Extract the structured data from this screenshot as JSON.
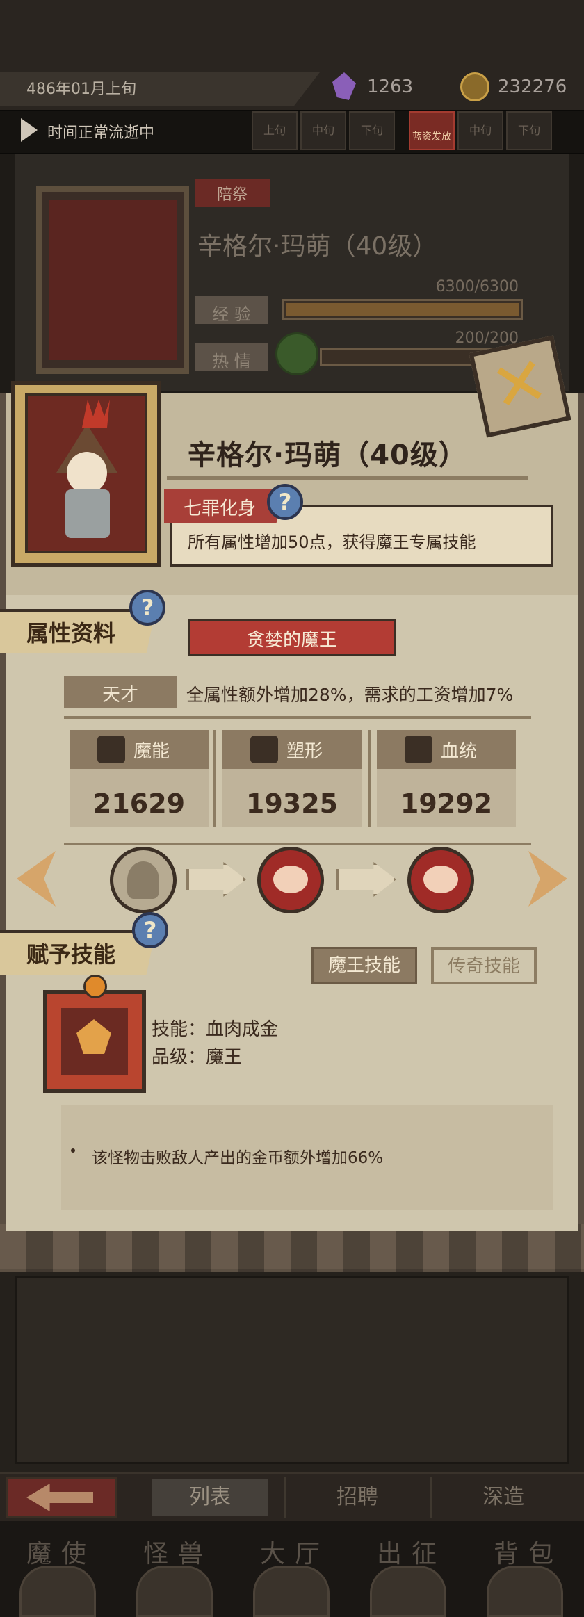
{
  "status": {
    "date": "486年01月上旬",
    "gems": "1263",
    "gold": "232276",
    "time_flow": "时间正常流逝中",
    "time_slots": [
      "上旬",
      "中旬",
      "下旬"
    ],
    "event_label": "蓝资发放",
    "time_slots_right": [
      "中旬",
      "下旬"
    ]
  },
  "background_card": {
    "tag": "陪祭",
    "name": "辛格尔·玛萌（40级）",
    "exp_label": "经 验",
    "exp_value": "6300/6300",
    "passion_label": "热 情",
    "passion_value": "200/200"
  },
  "character": {
    "name": "辛格尔·玛萌（40级）",
    "trait_tag": "七罪化身",
    "trait_desc": "所有属性增加50点，获得魔王专属技能",
    "close_icon": "close-icon"
  },
  "attributes": {
    "section_title": "属性资料",
    "title": "贪婪的魔王",
    "talent_label": "天才",
    "talent_desc": "全属性额外增加28%，需求的工资增加7%",
    "stats": [
      {
        "label": "魔能",
        "value": "21629",
        "icon": "magic-icon"
      },
      {
        "label": "塑形",
        "value": "19325",
        "icon": "body-icon"
      },
      {
        "label": "血统",
        "value": "19292",
        "icon": "bloodline-icon"
      }
    ],
    "accent": "#b33c34"
  },
  "skills": {
    "section_title": "赋予技能",
    "tab_active": "魔王技能",
    "tab_inactive": "传奇技能",
    "skill_name_line": "技能：血肉成金",
    "skill_grade_line": "品级：魔王",
    "skill_desc": "该怪物击败敌人产出的金币额外增加66%"
  },
  "nav": {
    "tabs": [
      "列表",
      "招聘",
      "深造"
    ],
    "dock": [
      "魔使",
      "怪兽",
      "大厅",
      "出征",
      "背包"
    ]
  },
  "help_mark": "?"
}
